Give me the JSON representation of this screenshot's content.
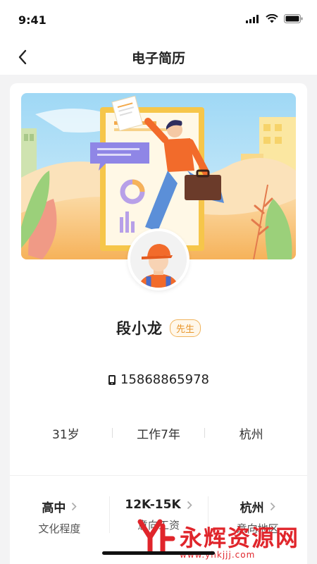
{
  "status": {
    "time": "9:41"
  },
  "nav": {
    "title": "电子简历"
  },
  "profile": {
    "name": "段小龙",
    "title_badge": "先生",
    "phone": "15868865978"
  },
  "stats": [
    "31岁",
    "工作7年",
    "杭州"
  ],
  "info": [
    {
      "value": "高中",
      "label": "文化程度"
    },
    {
      "value": "12K-15K",
      "label": "意向工资"
    },
    {
      "value": "杭州",
      "label": "意向地区"
    }
  ],
  "watermark": {
    "text": "永辉资源网",
    "url": "www.yhkjjj.com"
  },
  "colors": {
    "accent": "#e8962b",
    "background": "#f3f3f4",
    "card": "#ffffff"
  }
}
